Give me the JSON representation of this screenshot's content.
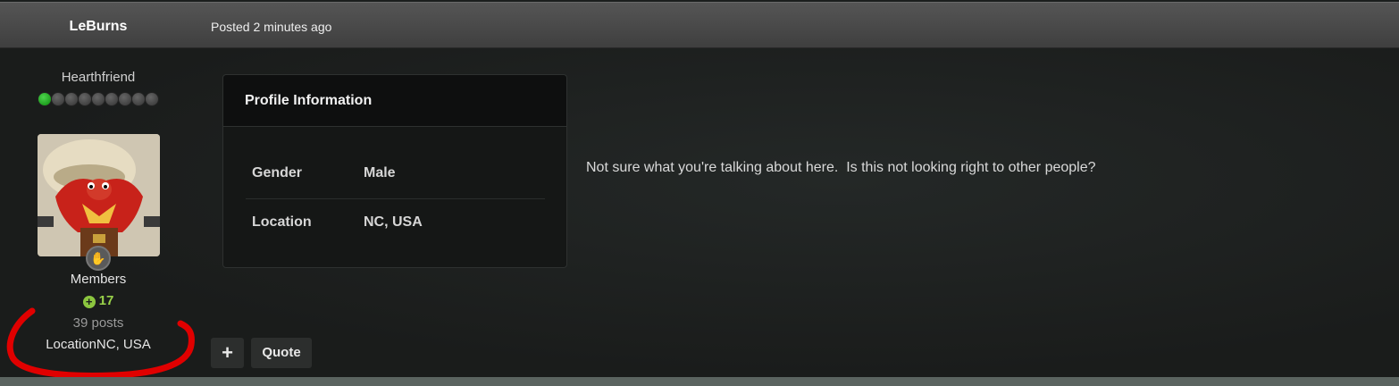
{
  "header": {
    "author": "LeBurns",
    "posted": "Posted 2 minutes ago"
  },
  "sidebar": {
    "rank_title": "Hearthfriend",
    "rank_pips_total": 9,
    "rank_pips_filled": 1,
    "group": "Members",
    "reputation": "17",
    "posts": "39 posts",
    "location": "LocationNC, USA"
  },
  "profile_card": {
    "title": "Profile Information",
    "rows": [
      {
        "label": "Gender",
        "value": "Male"
      },
      {
        "label": "Location",
        "value": "NC, USA"
      }
    ]
  },
  "post": {
    "text": "Not sure what you're talking about here.  Is this not looking right to other people?"
  },
  "actions": {
    "plus_label": "+",
    "quote_label": "Quote"
  },
  "colors": {
    "reputation": "#9ad34a",
    "annotation": "#e00000",
    "rank_pip_on": "#1fae1f"
  }
}
